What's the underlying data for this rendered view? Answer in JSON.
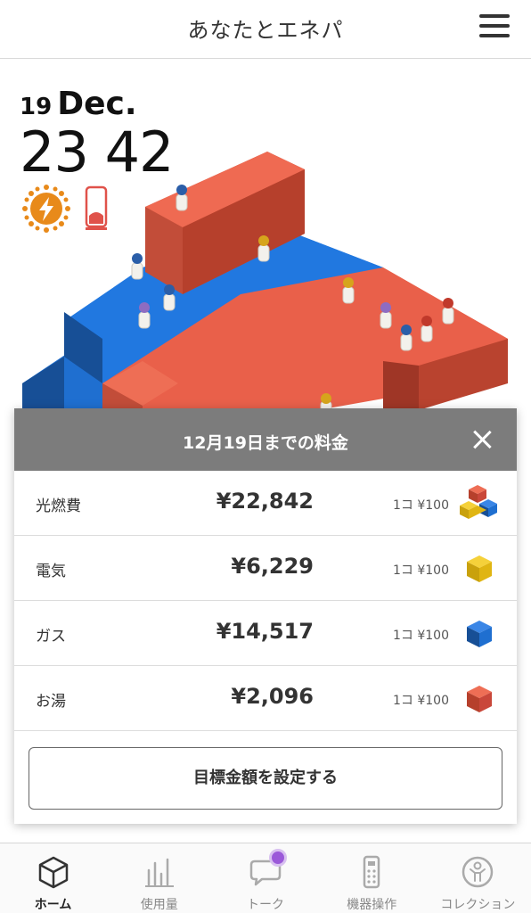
{
  "header": {
    "title": "あなたとエネパ",
    "menu_icon": "hamburger-menu-icon"
  },
  "clock": {
    "day": "19",
    "month": "Dec.",
    "time": "23 42"
  },
  "status": {
    "weather_icon": "sun-lightning-icon",
    "device_icon": "phone-icon",
    "accent_color": "#e88a1a",
    "device_color": "#e0524a"
  },
  "panel": {
    "title": "12月19日までの料金",
    "close_icon": "close-icon",
    "rows": [
      {
        "label": "光燃費",
        "amount": "¥22,842",
        "unit": "1コ ¥100",
        "cube": "mixed-cubes-icon"
      },
      {
        "label": "電気",
        "amount": "¥6,229",
        "unit": "1コ ¥100",
        "cube": "yellow-cube-icon",
        "color": "#f0c419"
      },
      {
        "label": "ガス",
        "amount": "¥14,517",
        "unit": "1コ ¥100",
        "cube": "blue-cube-icon",
        "color": "#1f6fd0"
      },
      {
        "label": "お湯",
        "amount": "¥2,096",
        "unit": "1コ ¥100",
        "cube": "red-cube-icon",
        "color": "#e0524a"
      }
    ],
    "target_button": "目標金額を設定する"
  },
  "scene": {
    "blue": "#1f6fd0",
    "red": "#e9604a"
  },
  "tabs": [
    {
      "label": "ホーム",
      "icon": "cube-icon",
      "active": true
    },
    {
      "label": "使用量",
      "icon": "bar-chart-icon",
      "active": false
    },
    {
      "label": "トーク",
      "icon": "chat-bubble-icon",
      "active": false
    },
    {
      "label": "機器操作",
      "icon": "remote-control-icon",
      "active": false
    },
    {
      "label": "コレクション",
      "icon": "collection-figure-icon",
      "active": false
    }
  ]
}
